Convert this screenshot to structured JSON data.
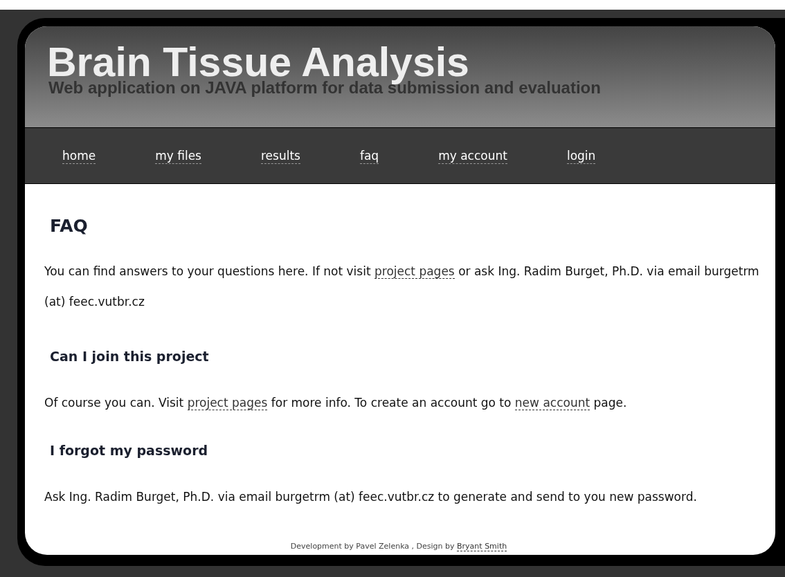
{
  "header": {
    "title": "Brain Tissue Analysis",
    "subtitle": "Web application on JAVA platform for data submission and evaluation"
  },
  "nav": [
    "home",
    "my files",
    "results",
    "faq",
    "my account",
    "login"
  ],
  "page_title": "FAQ",
  "intro": [
    {
      "text": "You can find answers to your questions here. If not visit "
    },
    {
      "text": "project pages",
      "link": true
    },
    {
      "text": " or ask Ing. Radim Burget, Ph.D. via email burgetrm (at) feec.vutbr.cz"
    }
  ],
  "sections": [
    {
      "heading": "Can I join this project",
      "body": [
        {
          "text": "Of course you can. Visit "
        },
        {
          "text": "project pages",
          "link": true
        },
        {
          "text": " for more info. To create an account go to "
        },
        {
          "text": "new account",
          "link": true
        },
        {
          "text": " page."
        }
      ]
    },
    {
      "heading": "I forgot my password",
      "body": [
        {
          "text": "Ask Ing. Radim Burget, Ph.D. via email burgetrm (at) feec.vutbr.cz to generate and send to you new password."
        }
      ]
    }
  ],
  "footer": [
    {
      "text": "Development by Pavel Zelenka , Design by "
    },
    {
      "text": "Bryant Smith",
      "link": true
    }
  ]
}
